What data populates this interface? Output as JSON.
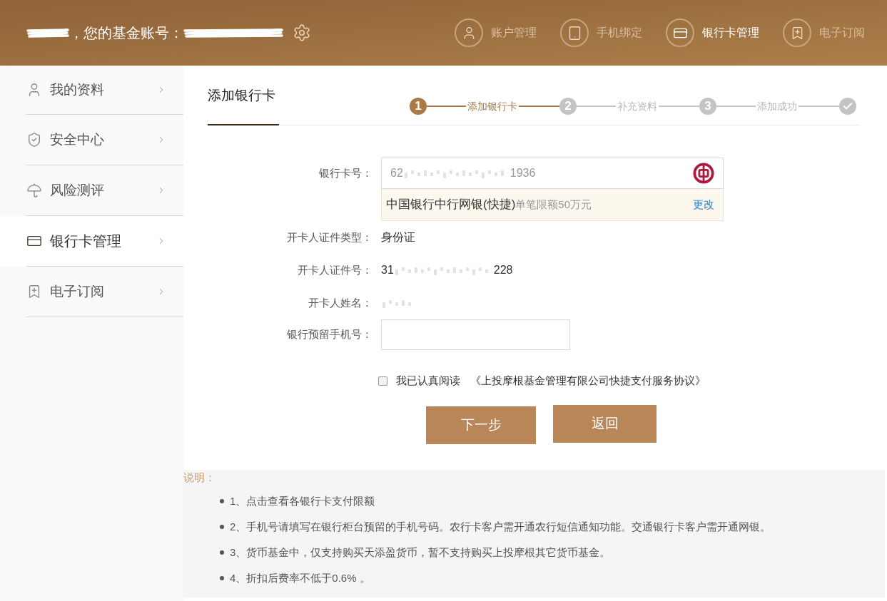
{
  "header": {
    "greeting": "，您的基金账号：",
    "nav": [
      {
        "label": "账户管理",
        "selected": false
      },
      {
        "label": "手机绑定",
        "selected": false
      },
      {
        "label": "银行卡管理",
        "selected": true
      },
      {
        "label": "电子订阅",
        "selected": false
      }
    ]
  },
  "sidebar": {
    "items": [
      {
        "label": "我的资料",
        "selected": false
      },
      {
        "label": "安全中心",
        "selected": false
      },
      {
        "label": "风险测评",
        "selected": false
      },
      {
        "label": "银行卡管理",
        "selected": true
      },
      {
        "label": "电子订阅",
        "selected": false
      }
    ]
  },
  "page_title": "添加银行卡",
  "steps": [
    {
      "number": "1",
      "label": "添加银行卡",
      "selected": true
    },
    {
      "number": "2",
      "label": "补充资料",
      "selected": false
    },
    {
      "number": "3",
      "label": "添加成功",
      "selected": false
    }
  ],
  "final_step": {
    "selected": false
  },
  "form": {
    "rows": [
      {
        "kind": "card",
        "label": "银行卡号：",
        "value_parts": [
          "62",
          "1936"
        ],
        "bank": {
          "name": "中国银行中行网银(快捷)",
          "limit": "单笔限额50万元",
          "action": "更改"
        }
      },
      {
        "kind": "text",
        "label": "开卡人证件类型：",
        "value": "身份证"
      },
      {
        "kind": "masked",
        "label": "开卡人证件号：",
        "value_parts": [
          "31",
          "228"
        ]
      },
      {
        "kind": "hidden",
        "label": "开卡人姓名："
      },
      {
        "kind": "input",
        "label": "银行预留手机号："
      }
    ]
  },
  "agreement": {
    "checked": false,
    "text": "我已认真阅读",
    "link": "《上投摩根基金管理有限公司快捷支付服务协议》"
  },
  "buttons": [
    "下一步",
    "返回"
  ],
  "notes": {
    "title": "说明：",
    "items": [
      "1、点击查看各银行卡支付限额",
      "2、手机号请填写在银行柜台预留的手机号码。农行卡客户需开通农行短信通知功能。交通银行卡客户需开通网银。",
      "3、货币基金中，仅支持购买天添盈货币，暂不支持购买上投摩根其它货币基金。",
      "4、折扣后费率不低于0.6% 。"
    ]
  }
}
